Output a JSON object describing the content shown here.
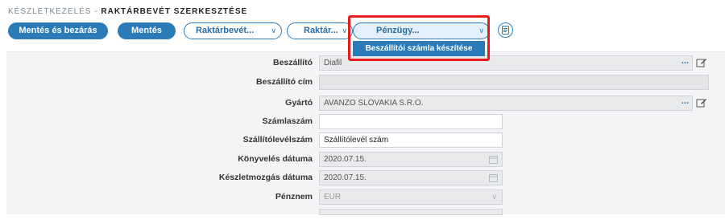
{
  "breadcrumb": {
    "section": "KÉSZLETKEZELÉS -",
    "page": "RAKTÁRBEVÉT SZERKESZTÉSE"
  },
  "toolbar": {
    "save_close_label": "Mentés és bezárás",
    "save_label": "Mentés",
    "stock_receipt_label": "Raktárbevét...",
    "warehouse_label": "Raktár...",
    "finance_label": "Pénzügy...",
    "finance_menu_item": "Beszállítói számla készítése",
    "export_icon": "document-export-icon"
  },
  "form": {
    "supplier": {
      "label": "Beszállító",
      "value": "Diafil",
      "more": "..."
    },
    "supplier_address": {
      "label": "Beszállító cím",
      "value": ""
    },
    "manufacturer": {
      "label": "Gyártó",
      "value": "AVANZO SLOVAKIA S.R.O.",
      "more": "..."
    },
    "invoice_number": {
      "label": "Számlaszám",
      "value": ""
    },
    "delivery_note_number": {
      "label": "Szállítólevélszám",
      "value": "Szállítólevél szám"
    },
    "posting_date": {
      "label": "Könyvelés dátuma",
      "value": "2020.07.15."
    },
    "stock_movement_date": {
      "label": "Készletmozgás dátuma",
      "value": "2020.07.15."
    },
    "currency": {
      "label": "Pénznem",
      "value": "EUR"
    }
  },
  "colors": {
    "primary": "#2b7bb9",
    "highlight": "#e61b1b",
    "panel": "#f3f4f6"
  }
}
